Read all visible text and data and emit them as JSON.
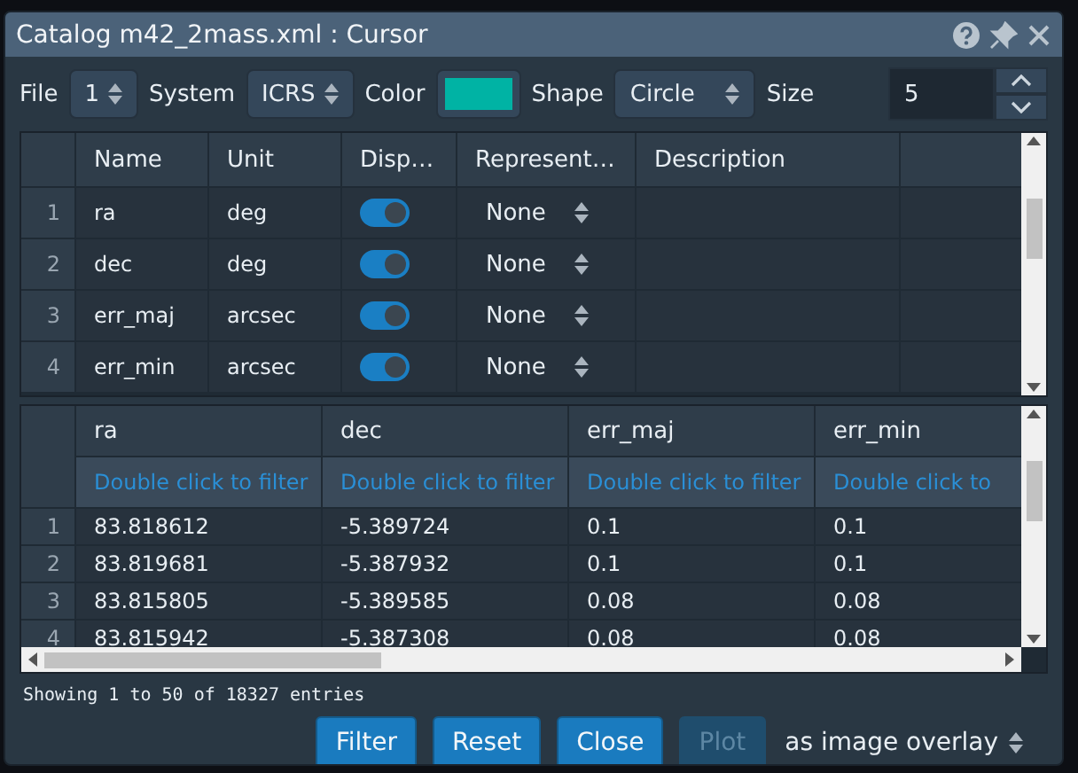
{
  "window": {
    "title": "Catalog m42_2mass.xml : Cursor"
  },
  "toolbar": {
    "file_label": "File",
    "file": "1",
    "system_label": "System",
    "system": "ICRS",
    "color_label": "Color",
    "color": "#00b3a4",
    "shape_label": "Shape",
    "shape": "Circle",
    "size_label": "Size",
    "size": "5"
  },
  "columns_table": {
    "headers": [
      "Name",
      "Unit",
      "Disp…",
      "Represent…",
      "Description"
    ],
    "rows": [
      {
        "index": "1",
        "name": "ra",
        "unit": "deg",
        "displayed": true,
        "representation": "None"
      },
      {
        "index": "2",
        "name": "dec",
        "unit": "deg",
        "displayed": true,
        "representation": "None"
      },
      {
        "index": "3",
        "name": "err_maj",
        "unit": "arcsec",
        "displayed": true,
        "representation": "None"
      },
      {
        "index": "4",
        "name": "err_min",
        "unit": "arcsec",
        "displayed": true,
        "representation": "None"
      }
    ]
  },
  "data_table": {
    "columns": [
      {
        "name": "ra",
        "filter_hint": "Double click to filter"
      },
      {
        "name": "dec",
        "filter_hint": "Double click to filter"
      },
      {
        "name": "err_maj",
        "filter_hint": "Double click to filter"
      },
      {
        "name": "err_min",
        "filter_hint": "Double click to"
      }
    ],
    "rows": [
      {
        "index": "1",
        "cells": [
          "83.818612",
          "-5.389724",
          "0.1",
          "0.1"
        ]
      },
      {
        "index": "2",
        "cells": [
          "83.819681",
          "-5.387932",
          "0.1",
          "0.1"
        ]
      },
      {
        "index": "3",
        "cells": [
          "83.815805",
          "-5.389585",
          "0.08",
          "0.08"
        ]
      },
      {
        "index": "4",
        "cells": [
          "83.815942",
          "-5.387308",
          "0.08",
          "0.08"
        ]
      }
    ]
  },
  "status": "Showing 1 to 50 of 18327 entries",
  "buttons": [
    {
      "label": "Filter",
      "disabled": false
    },
    {
      "label": "Reset",
      "disabled": false
    },
    {
      "label": "Close",
      "disabled": false
    },
    {
      "label": "Plot",
      "disabled": true
    }
  ],
  "plot_mode": "as image overlay"
}
